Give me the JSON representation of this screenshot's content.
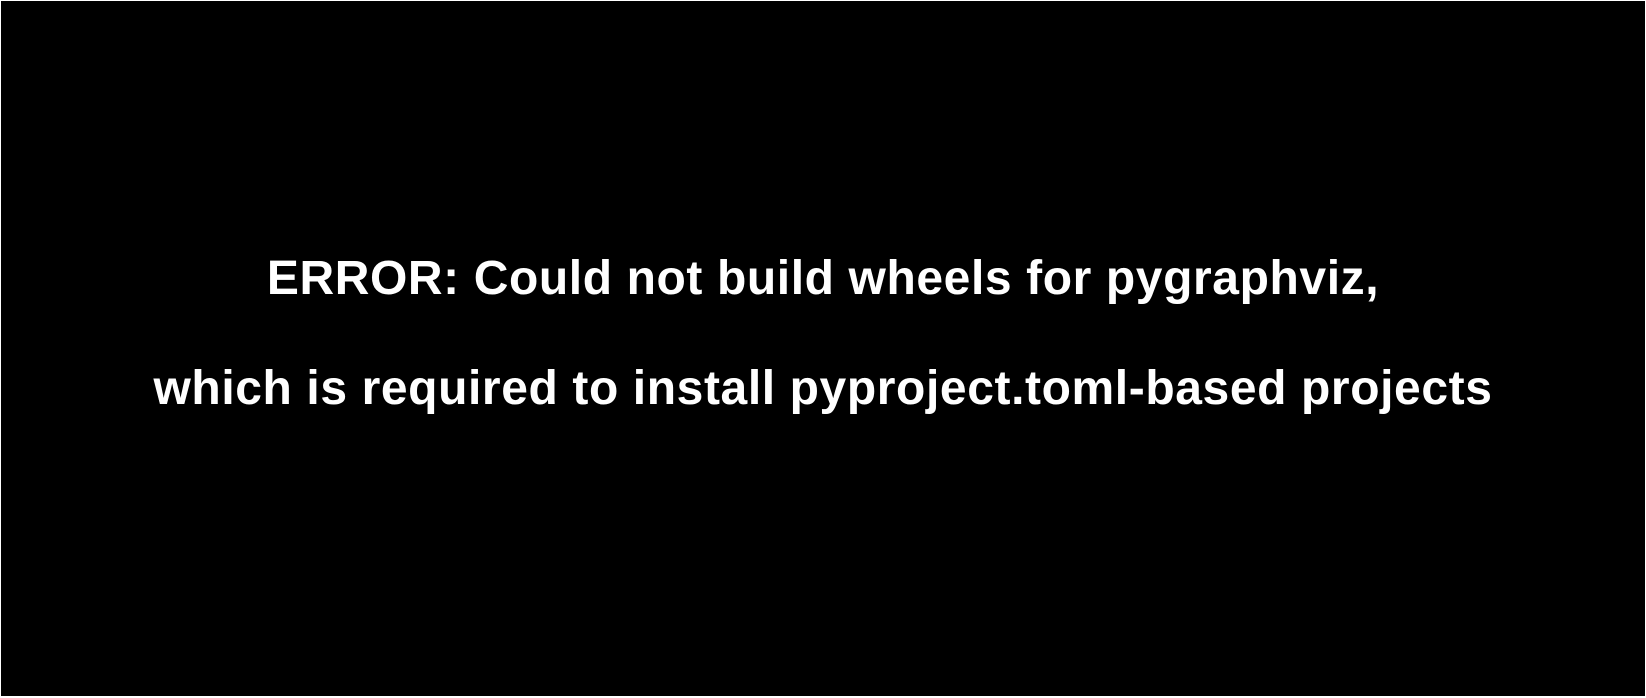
{
  "message": {
    "line1": "ERROR: Could not build wheels for pygraphviz,",
    "line2": "which is required to install pyproject.toml-based projects"
  },
  "colors": {
    "background": "#000000",
    "text": "#ffffff",
    "border": "#ffffff"
  }
}
